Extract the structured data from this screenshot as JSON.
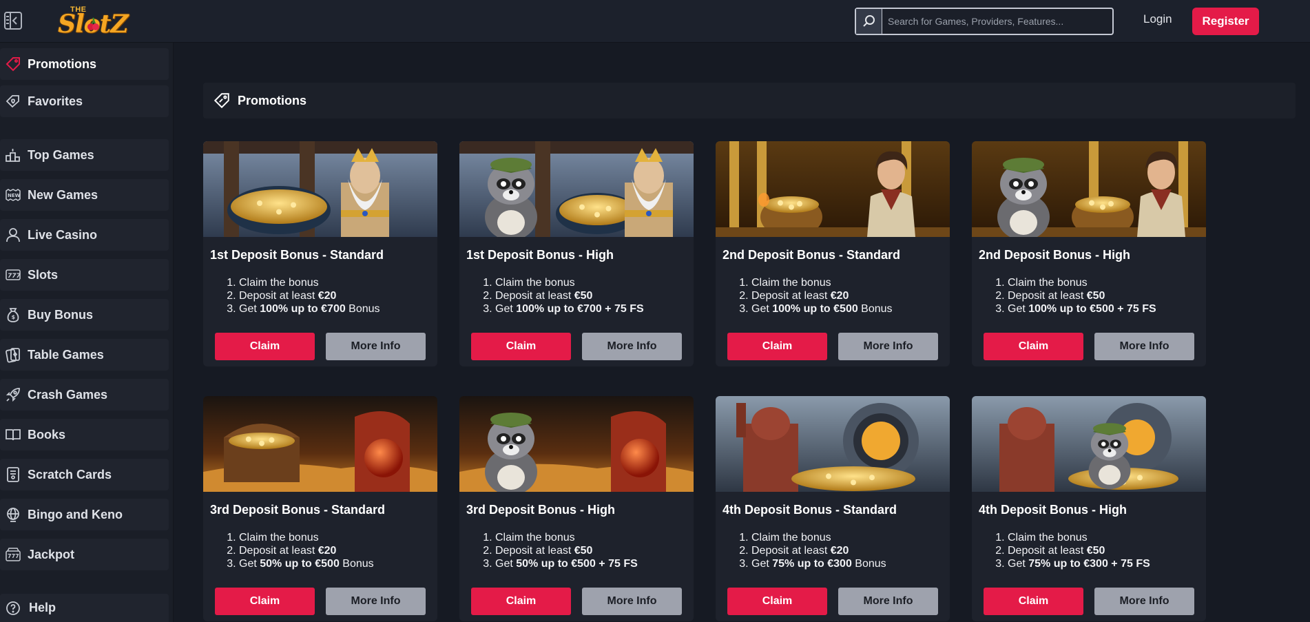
{
  "header": {
    "logo_small": "THE",
    "logo_text": "SlotZ",
    "search_placeholder": "Search for Games, Providers, Features...",
    "login_label": "Login",
    "register_label": "Register"
  },
  "sidebar": {
    "top_items": [
      {
        "label": "Promotions",
        "icon": "tag-icon",
        "active": true
      },
      {
        "label": "Favorites",
        "icon": "heart-tag-icon"
      }
    ],
    "items": [
      {
        "label": "Top Games",
        "icon": "podium-icon"
      },
      {
        "label": "New Games",
        "icon": "new-badge-icon"
      },
      {
        "label": "Live Casino",
        "icon": "dealer-icon"
      },
      {
        "label": "Slots",
        "icon": "slot-777-icon"
      },
      {
        "label": "Buy Bonus",
        "icon": "money-bag-icon"
      },
      {
        "label": "Table Games",
        "icon": "cards-icon"
      },
      {
        "label": "Crash Games",
        "icon": "rocket-icon"
      },
      {
        "label": "Books",
        "icon": "book-icon"
      },
      {
        "label": "Scratch Cards",
        "icon": "scratch-card-icon"
      },
      {
        "label": "Bingo and Keno",
        "icon": "globe-icon"
      },
      {
        "label": "Jackpot",
        "icon": "jackpot-icon"
      }
    ],
    "help_label": "Help"
  },
  "main": {
    "section_title": "Promotions",
    "claim_label": "Claim",
    "info_label": "More Info",
    "step1": "Claim the bonus",
    "step2_prefix": "Deposit at least ",
    "step3_prefix": "Get ",
    "cards": [
      {
        "title": "1st Deposit Bonus - Standard",
        "deposit": "€20",
        "reward": "100% up to €700",
        "suffix": " Bonus",
        "art": "zeus"
      },
      {
        "title": "1st Deposit Bonus - High",
        "deposit": "€50",
        "reward": "100% up to €700 + 75 FS",
        "suffix": "",
        "art": "zeus-raccoon"
      },
      {
        "title": "2nd Deposit Bonus - Standard",
        "deposit": "€20",
        "reward": "100% up to €500",
        "suffix": " Bonus",
        "art": "explorer"
      },
      {
        "title": "2nd Deposit Bonus - High",
        "deposit": "€50",
        "reward": "100% up to €500 + 75 FS",
        "suffix": "",
        "art": "explorer-raccoon"
      },
      {
        "title": "3rd Deposit Bonus - Standard",
        "deposit": "€20",
        "reward": "50% up to €500",
        "suffix": " Bonus",
        "art": "desert"
      },
      {
        "title": "3rd Deposit Bonus - High",
        "deposit": "€50",
        "reward": "50% up to €500 + 75 FS",
        "suffix": "",
        "art": "desert-raccoon"
      },
      {
        "title": "4th Deposit Bonus - Standard",
        "deposit": "€20",
        "reward": "75% up to €300",
        "suffix": " Bonus",
        "art": "vault"
      },
      {
        "title": "4th Deposit Bonus - High",
        "deposit": "€50",
        "reward": "75% up to €300 + 75 FS",
        "suffix": "",
        "art": "vault-raccoon"
      }
    ]
  },
  "colors": {
    "accent": "#e41b48",
    "background": "#161a23",
    "panel": "#1e222c",
    "secondary_button": "#9ea2ad"
  }
}
